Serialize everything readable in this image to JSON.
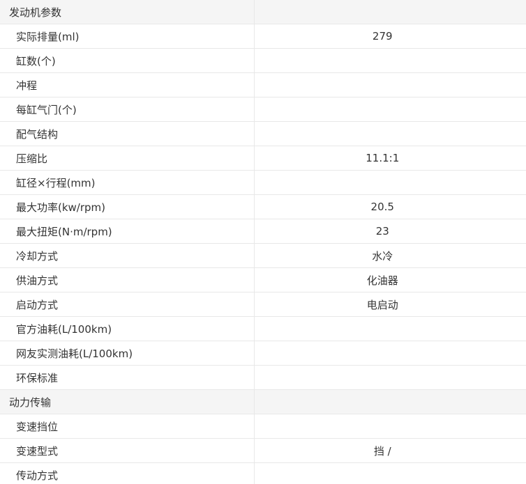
{
  "sections": [
    {
      "title": "发动机参数",
      "rows": [
        {
          "label": "实际排量(ml)",
          "value": "279"
        },
        {
          "label": "缸数(个)",
          "value": ""
        },
        {
          "label": "冲程",
          "value": ""
        },
        {
          "label": "每缸气门(个)",
          "value": ""
        },
        {
          "label": "配气结构",
          "value": ""
        },
        {
          "label": "压缩比",
          "value": "11.1:1"
        },
        {
          "label": "缸径×行程(mm)",
          "value": ""
        },
        {
          "label": "最大功率(kw/rpm)",
          "value": "20.5"
        },
        {
          "label": "最大扭矩(N·m/rpm)",
          "value": "23"
        },
        {
          "label": "冷却方式",
          "value": "水冷"
        },
        {
          "label": "供油方式",
          "value": "化油器"
        },
        {
          "label": "启动方式",
          "value": "电启动"
        },
        {
          "label": "官方油耗(L/100km)",
          "value": ""
        },
        {
          "label": "网友实测油耗(L/100km)",
          "value": ""
        },
        {
          "label": "环保标准",
          "value": ""
        }
      ]
    },
    {
      "title": "动力传输",
      "rows": [
        {
          "label": "变速挡位",
          "value": ""
        },
        {
          "label": "变速型式",
          "value": "挡 /"
        },
        {
          "label": "传动方式",
          "value": ""
        }
      ]
    }
  ]
}
